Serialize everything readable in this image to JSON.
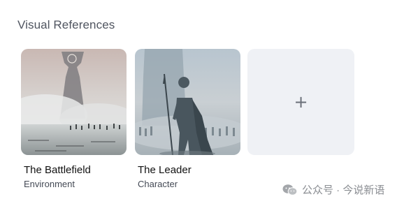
{
  "section": {
    "title": "Visual References"
  },
  "cards": [
    {
      "title": "The Battlefield",
      "subtitle": "Environment",
      "image_icon": "battlefield-image"
    },
    {
      "title": "The Leader",
      "subtitle": "Character",
      "image_icon": "leader-image"
    }
  ],
  "add_tile": {
    "icon": "+"
  },
  "watermark": {
    "text": "公众号 · 今说新语"
  },
  "colors": {
    "tile_bg": "#eff1f5",
    "title_text": "#505560"
  }
}
